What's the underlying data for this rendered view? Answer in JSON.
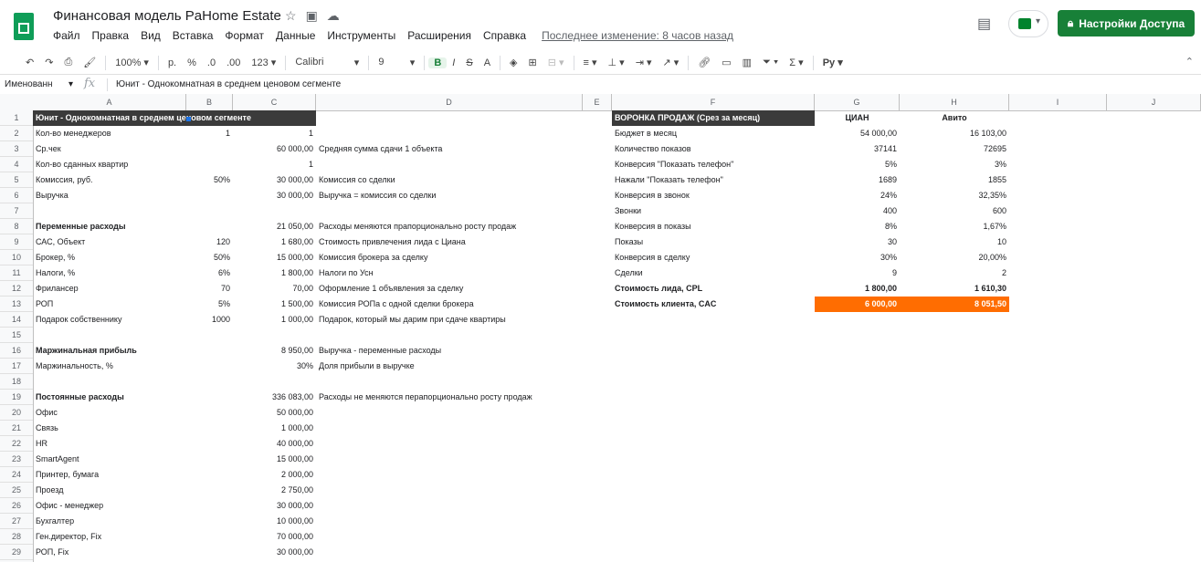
{
  "app": {
    "doc_title": "Финансовая модель PaHome Estate",
    "menus": [
      "Файл",
      "Правка",
      "Вид",
      "Вставка",
      "Формат",
      "Данные",
      "Инструменты",
      "Расширения",
      "Справка"
    ],
    "last_edit": "Последнее изменение: 8 часов назад",
    "share_label": "Настройки Доступа"
  },
  "toolbar": {
    "zoom": "100%",
    "currency": "р.",
    "percent": "%",
    "dec_less": ".0",
    "dec_more": ".00",
    "format_more": "123",
    "font": "Calibri",
    "font_size": "9",
    "bold": "B",
    "strike": "S",
    "text_color": "A",
    "script": "Рy"
  },
  "formula_bar": {
    "namebox": "Именованн",
    "fx": "fx",
    "formula": "Юнит - Однокомнатная в среднем ценовом сегменте"
  },
  "columns": [
    "A",
    "B",
    "C",
    "D",
    "E",
    "F",
    "G",
    "H",
    "I",
    "J"
  ],
  "rows": [
    "1",
    "2",
    "3",
    "4",
    "5",
    "6",
    "7",
    "8",
    "9",
    "10",
    "11",
    "12",
    "13",
    "14",
    "15",
    "16",
    "17",
    "18",
    "19",
    "20",
    "21",
    "22",
    "23",
    "24",
    "25",
    "26",
    "27",
    "28",
    "29"
  ],
  "unit": {
    "header": "Юнит - Однокомнатная в среднем ценовом сегменте",
    "rows": [
      {
        "r": 2,
        "a": "Кол-во менеджеров",
        "b": "1",
        "c": "1",
        "d": ""
      },
      {
        "r": 3,
        "a": "Ср.чек",
        "b": "",
        "c": "60 000,00",
        "d": "Средняя сумма сдачи 1 объекта"
      },
      {
        "r": 4,
        "a": "Кол-во сданных квартир",
        "b": "",
        "c": "1",
        "d": ""
      },
      {
        "r": 5,
        "a": "Комиссия, руб.",
        "b": "50%",
        "c": "30 000,00",
        "d": "Комиссия со сделки"
      },
      {
        "r": 6,
        "a": "Выручка",
        "b": "",
        "c": "30 000,00",
        "d": "Выручка = комиссия со сделки"
      },
      {
        "r": 8,
        "a": "Переменные расходы",
        "b": "",
        "c": "21 050,00",
        "d": "Расходы меняются прапорционально росту продаж",
        "bold": true
      },
      {
        "r": 9,
        "a": "САС, Объект",
        "b": "120",
        "c": "1 680,00",
        "d": "Стоимость привлечения лида с Циана"
      },
      {
        "r": 10,
        "a": "Брокер, %",
        "b": "50%",
        "c": "15 000,00",
        "d": "Комиссия брокера за сделку"
      },
      {
        "r": 11,
        "a": "Налоги, %",
        "b": "6%",
        "c": "1 800,00",
        "d": "Налоги по Усн"
      },
      {
        "r": 12,
        "a": "Фрилансер",
        "b": "70",
        "c": "70,00",
        "d": "Оформление 1 объявления за сделку"
      },
      {
        "r": 13,
        "a": "РОП",
        "b": "5%",
        "c": "1 500,00",
        "d": "Комиссия РОПа с одной сделки брокера"
      },
      {
        "r": 14,
        "a": "Подарок собственнику",
        "b": "1000",
        "c": "1 000,00",
        "d": "Подарок, который мы дарим при сдаче квартиры"
      },
      {
        "r": 16,
        "a": "Маржинальная прибыль",
        "b": "",
        "c": "8 950,00",
        "d": "Выручка - переменные расходы",
        "bold": true
      },
      {
        "r": 17,
        "a": "Маржинальность, %",
        "b": "",
        "c": "30%",
        "d": "Доля прибыли в выручке"
      },
      {
        "r": 19,
        "a": "Постоянные расходы",
        "b": "",
        "c": "336 083,00",
        "d": "Расходы не меняются перапорционально росту продаж",
        "bold": true
      },
      {
        "r": 20,
        "a": "Офис",
        "b": "",
        "c": "50 000,00",
        "d": ""
      },
      {
        "r": 21,
        "a": "Связь",
        "b": "",
        "c": "1 000,00",
        "d": ""
      },
      {
        "r": 22,
        "a": "HR",
        "b": "",
        "c": "40 000,00",
        "d": ""
      },
      {
        "r": 23,
        "a": "SmartAgent",
        "b": "",
        "c": "15 000,00",
        "d": ""
      },
      {
        "r": 24,
        "a": "Принтер, бумага",
        "b": "",
        "c": "2 000,00",
        "d": ""
      },
      {
        "r": 25,
        "a": "Проезд",
        "b": "",
        "c": "2 750,00",
        "d": ""
      },
      {
        "r": 26,
        "a": "Офис - менеджер",
        "b": "",
        "c": "30 000,00",
        "d": ""
      },
      {
        "r": 27,
        "a": "Бухгалтер",
        "b": "",
        "c": "10 000,00",
        "d": ""
      },
      {
        "r": 28,
        "a": "Ген.директор, Fix",
        "b": "",
        "c": "70 000,00",
        "d": ""
      },
      {
        "r": 29,
        "a": "РОП, Fix",
        "b": "",
        "c": "30 000,00",
        "d": ""
      }
    ]
  },
  "funnel": {
    "header": "ВОРОНКА ПРОДАЖ (Срез за месяц)",
    "g_header": "ЦИАН",
    "h_header": "Авито",
    "rows": [
      {
        "r": 2,
        "f": "Бюджет в месяц",
        "g": "54 000,00",
        "h": "16 103,00"
      },
      {
        "r": 3,
        "f": "Количество показов",
        "g": "37141",
        "h": "72695"
      },
      {
        "r": 4,
        "f": "Конверсия \"Показать телефон\"",
        "g": "5%",
        "h": "3%"
      },
      {
        "r": 5,
        "f": "Нажали \"Показать телефон\"",
        "g": "1689",
        "h": "1855"
      },
      {
        "r": 6,
        "f": "Конверсия в звонок",
        "g": "24%",
        "h": "32,35%"
      },
      {
        "r": 7,
        "f": "Звонки",
        "g": "400",
        "h": "600"
      },
      {
        "r": 8,
        "f": "Конверсия в показы",
        "g": "8%",
        "h": "1,67%"
      },
      {
        "r": 9,
        "f": "Показы",
        "g": "30",
        "h": "10"
      },
      {
        "r": 10,
        "f": "Конверсия в сделку",
        "g": "30%",
        "h": "20,00%"
      },
      {
        "r": 11,
        "f": "Сделки",
        "g": "9",
        "h": "2"
      },
      {
        "r": 12,
        "f": "Стоимость лида, CPL",
        "g": "1 800,00",
        "h": "1 610,30",
        "bold": true
      },
      {
        "r": 13,
        "f": "Стоимость клиента, CAC",
        "g": "6 000,00",
        "h": "8 051,50",
        "bold": true,
        "highlight": true
      }
    ]
  },
  "colors": {
    "share": "#188038",
    "dark_header": "#3b3b3b",
    "highlight": "#ff6d01"
  }
}
